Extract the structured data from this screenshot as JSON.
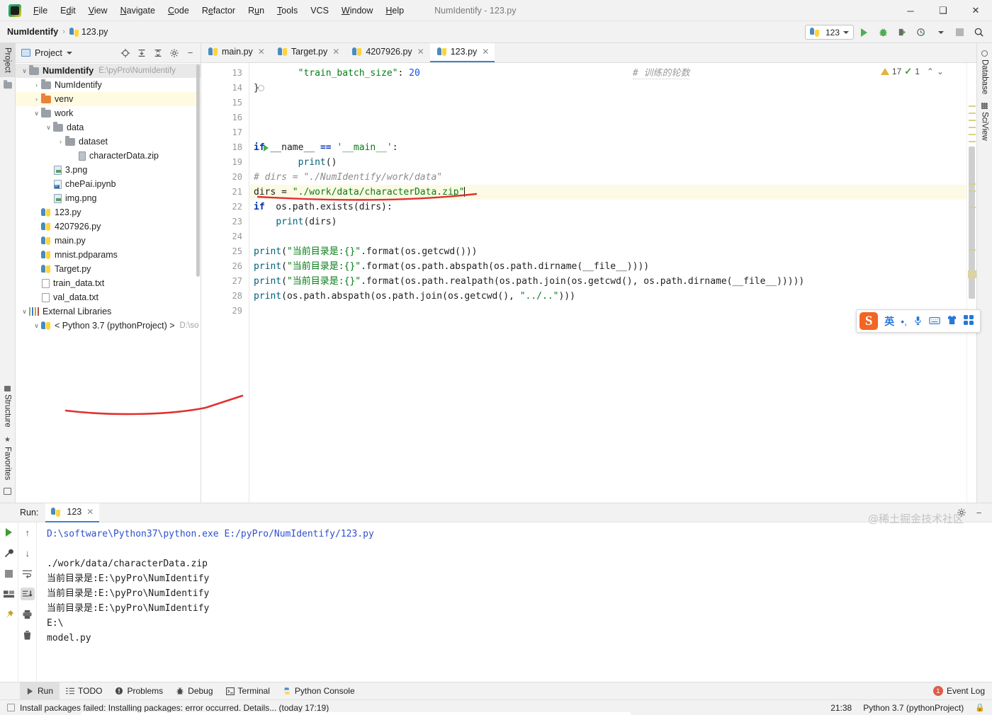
{
  "window": {
    "title": "NumIdentify - 123.py",
    "menu": [
      "File",
      "Edit",
      "View",
      "Navigate",
      "Code",
      "Refactor",
      "Run",
      "Tools",
      "VCS",
      "Window",
      "Help"
    ],
    "controls": {
      "minimize": "─",
      "maximize": "❑",
      "close": "✕"
    }
  },
  "navbar": {
    "project_name": "NumIdentify",
    "separator": "›",
    "file_name": "123.py",
    "run_config": "123",
    "buttons": {
      "run": "run-button",
      "debug": "debug-button",
      "coverage": "coverage-button",
      "profile": "profile-button",
      "stop": "stop-button",
      "search": "search-everywhere"
    }
  },
  "left_rail": {
    "top": [
      "Project"
    ],
    "bottom": [
      "Favorites",
      "Structure"
    ]
  },
  "right_rail": [
    "Database",
    "SciView"
  ],
  "project_panel": {
    "title": "Project",
    "tree": [
      {
        "indent": 0,
        "arrow": "∨",
        "icon": "folder",
        "label": "NumIdentify",
        "path": "E:\\pyPro\\NumIdentify",
        "bold": true,
        "header": true
      },
      {
        "indent": 1,
        "arrow": "›",
        "icon": "folder",
        "label": "NumIdentify",
        "path": ""
      },
      {
        "indent": 1,
        "arrow": "›",
        "icon": "folder-orange",
        "label": "venv",
        "path": "",
        "selected": true
      },
      {
        "indent": 1,
        "arrow": "∨",
        "icon": "folder",
        "label": "work",
        "path": ""
      },
      {
        "indent": 2,
        "arrow": "∨",
        "icon": "folder",
        "label": "data",
        "path": ""
      },
      {
        "indent": 3,
        "arrow": "›",
        "icon": "folder",
        "label": "dataset",
        "path": ""
      },
      {
        "indent": 4,
        "arrow": "",
        "icon": "zip",
        "label": "characterData.zip",
        "path": ""
      },
      {
        "indent": 2,
        "arrow": "",
        "icon": "img",
        "label": "3.png",
        "path": ""
      },
      {
        "indent": 2,
        "arrow": "",
        "icon": "notebook",
        "label": "chePai.ipynb",
        "path": ""
      },
      {
        "indent": 2,
        "arrow": "",
        "icon": "img",
        "label": "img.png",
        "path": ""
      },
      {
        "indent": 1,
        "arrow": "",
        "icon": "python",
        "label": "123.py",
        "path": ""
      },
      {
        "indent": 1,
        "arrow": "",
        "icon": "python",
        "label": "4207926.py",
        "path": ""
      },
      {
        "indent": 1,
        "arrow": "",
        "icon": "python",
        "label": "main.py",
        "path": ""
      },
      {
        "indent": 1,
        "arrow": "",
        "icon": "python-q",
        "label": "mnist.pdparams",
        "path": ""
      },
      {
        "indent": 1,
        "arrow": "",
        "icon": "python",
        "label": "Target.py",
        "path": ""
      },
      {
        "indent": 1,
        "arrow": "",
        "icon": "file",
        "label": "train_data.txt",
        "path": ""
      },
      {
        "indent": 1,
        "arrow": "",
        "icon": "file",
        "label": "val_data.txt",
        "path": ""
      },
      {
        "indent": 0,
        "arrow": "∨",
        "icon": "library",
        "label": "External Libraries",
        "path": ""
      },
      {
        "indent": 1,
        "arrow": "∨",
        "icon": "python",
        "label": "< Python 3.7 (pythonProject) >",
        "path": "D:\\so"
      }
    ]
  },
  "editor": {
    "tabs": [
      {
        "label": "main.py",
        "active": false
      },
      {
        "label": "Target.py",
        "active": false
      },
      {
        "label": "4207926.py",
        "active": false
      },
      {
        "label": "123.py",
        "active": true
      }
    ],
    "inspection": {
      "warning_count": "17",
      "ok_count": "1",
      "up": "⌃",
      "down": "⌄"
    },
    "first_line_number": 13,
    "lines": [
      {
        "n": 13,
        "segments": [
          {
            "t": "        ",
            "c": "id"
          },
          {
            "t": "\"train_batch_size\"",
            "c": "str"
          },
          {
            "t": ": ",
            "c": "id"
          },
          {
            "t": "20",
            "c": "num"
          }
        ],
        "trailing_comment": "# 训练的轮数"
      },
      {
        "n": 14,
        "fold": true,
        "segments": [
          {
            "t": "}",
            "c": "id"
          }
        ]
      },
      {
        "n": 15,
        "segments": []
      },
      {
        "n": 16,
        "segments": []
      },
      {
        "n": 17,
        "segments": []
      },
      {
        "n": 18,
        "gutter_run": true,
        "segments": [
          {
            "t": "if ",
            "c": "kw"
          },
          {
            "t": "__name__ ",
            "c": "id"
          },
          {
            "t": "== ",
            "c": "kw"
          },
          {
            "t": "'__main__'",
            "c": "str"
          },
          {
            "t": ":",
            "c": "id"
          }
        ]
      },
      {
        "n": 19,
        "segments": [
          {
            "t": "        ",
            "c": "id"
          },
          {
            "t": "print",
            "c": "fn"
          },
          {
            "t": "()",
            "c": "id"
          }
        ]
      },
      {
        "n": 20,
        "segments": [
          {
            "t": "# dirs = \"./NumIdentify/work/data\"",
            "c": "cmt"
          }
        ]
      },
      {
        "n": 21,
        "highlight": true,
        "caret": true,
        "segments": [
          {
            "t": "dirs = ",
            "c": "id"
          },
          {
            "t": "\"./work/data/characterData.zip\"",
            "c": "str"
          }
        ]
      },
      {
        "n": 22,
        "segments": [
          {
            "t": "if ",
            "c": "kw"
          },
          {
            "t": " os.path.exists(dirs):",
            "c": "id"
          }
        ]
      },
      {
        "n": 23,
        "segments": [
          {
            "t": "    ",
            "c": "id"
          },
          {
            "t": "print",
            "c": "fn"
          },
          {
            "t": "(dirs)",
            "c": "id"
          }
        ]
      },
      {
        "n": 24,
        "segments": []
      },
      {
        "n": 25,
        "segments": [
          {
            "t": "print",
            "c": "fn"
          },
          {
            "t": "(",
            "c": "id"
          },
          {
            "t": "\"当前目录是:{}\"",
            "c": "str"
          },
          {
            "t": ".format(os.getcwd()))",
            "c": "id"
          }
        ]
      },
      {
        "n": 26,
        "segments": [
          {
            "t": "print",
            "c": "fn"
          },
          {
            "t": "(",
            "c": "id"
          },
          {
            "t": "\"当前目录是:{}\"",
            "c": "str"
          },
          {
            "t": ".format(os.path.abspath(os.path.dirname(__file__))))",
            "c": "id"
          }
        ]
      },
      {
        "n": 27,
        "segments": [
          {
            "t": "print",
            "c": "fn"
          },
          {
            "t": "(",
            "c": "id"
          },
          {
            "t": "\"当前目录是:{}\"",
            "c": "str"
          },
          {
            "t": ".format(os.path.realpath(os.path.join(os.getcwd(), os.path.dirname(__file__)))))",
            "c": "id"
          }
        ]
      },
      {
        "n": 28,
        "segments": [
          {
            "t": "print",
            "c": "fn"
          },
          {
            "t": "(os.path.abspath(os.path.join(os.getcwd(), ",
            "c": "id"
          },
          {
            "t": "\"../..\"",
            "c": "str"
          },
          {
            "t": ")))",
            "c": "id"
          }
        ]
      },
      {
        "n": 29,
        "segments": []
      }
    ]
  },
  "ime": {
    "logo": "S",
    "mode": "英",
    "punctuation": "•,",
    "mic": "mic",
    "keyboard": "keyboard",
    "skin": "skin",
    "apps": "apps"
  },
  "run_panel": {
    "label": "Run:",
    "tab": "123",
    "lines": [
      {
        "text": "D:\\software\\Python37\\python.exe E:/pyPro/NumIdentify/123.py",
        "kind": "link"
      },
      {
        "text": "",
        "kind": "out"
      },
      {
        "text": "./work/data/characterData.zip",
        "kind": "out"
      },
      {
        "text": "当前目录是:E:\\pyPro\\NumIdentify",
        "kind": "out"
      },
      {
        "text": "当前目录是:E:\\pyPro\\NumIdentify",
        "kind": "out"
      },
      {
        "text": "当前目录是:E:\\pyPro\\NumIdentify",
        "kind": "out"
      },
      {
        "text": "E:\\",
        "kind": "out"
      },
      {
        "text": "model.py",
        "kind": "out"
      }
    ]
  },
  "bottom_tabs": [
    {
      "label": "Run",
      "icon": "run-icon",
      "active": true
    },
    {
      "label": "TODO",
      "icon": "todo-icon",
      "active": false
    },
    {
      "label": "Problems",
      "icon": "problems-icon",
      "active": false
    },
    {
      "label": "Debug",
      "icon": "debug-icon",
      "active": false
    },
    {
      "label": "Terminal",
      "icon": "terminal-icon",
      "active": false
    },
    {
      "label": "Python Console",
      "icon": "python-console-icon",
      "active": false
    }
  ],
  "event_log": {
    "label": "Event Log",
    "count": "1"
  },
  "status_bar": {
    "message": "Install packages failed: Installing packages: error occurred. Details... (today 17:19)",
    "caret_position": "21:38",
    "interpreter": "Python 3.7 (pythonProject)",
    "lock": "🔒"
  },
  "watermark": "@稀土掘金技术社区",
  "colors": {
    "accent": "#4083c9",
    "string": "#067D17",
    "keyword": "#0033B3",
    "number": "#1750EB",
    "comment": "#8C8C8C",
    "function": "#00627A",
    "annotation": "#E03131",
    "warning": "#E3B33A",
    "ok": "#3F9C35"
  }
}
